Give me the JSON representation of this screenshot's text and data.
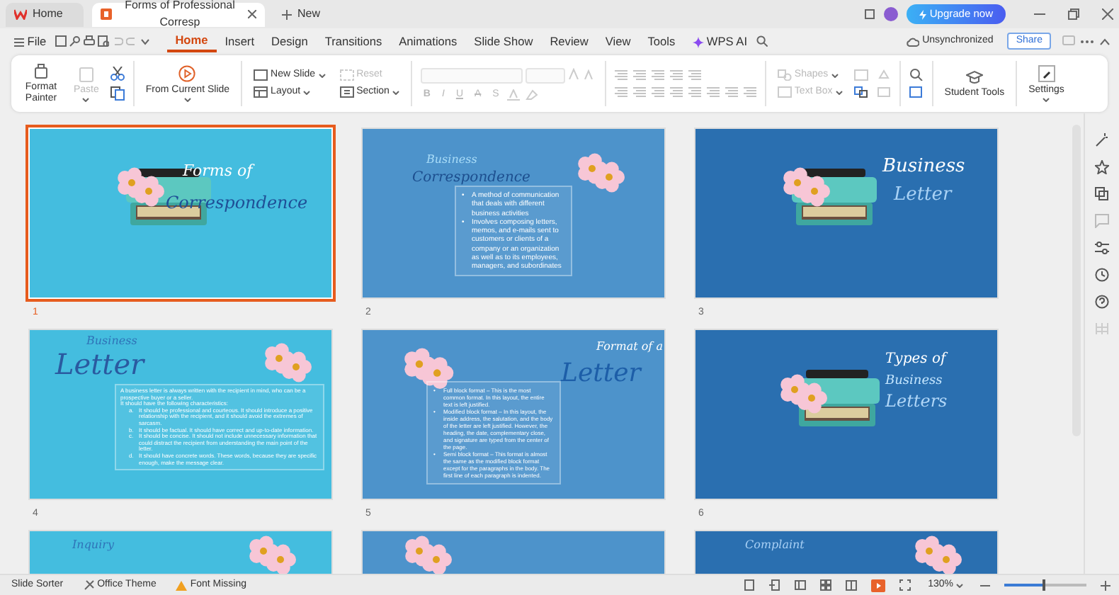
{
  "title_bar": {
    "tabs": [
      {
        "label": "Home",
        "selected": false
      },
      {
        "label": "Forms of Professional Corresp",
        "selected": true
      }
    ],
    "new_tab": "New",
    "upgrade": "Upgrade now"
  },
  "menu": {
    "file": "File",
    "tabs": [
      {
        "label": "Home",
        "selected": true
      },
      {
        "label": "Insert",
        "selected": false
      },
      {
        "label": "Design",
        "selected": false
      },
      {
        "label": "Transitions",
        "selected": false
      },
      {
        "label": "Animations",
        "selected": false
      },
      {
        "label": "Slide Show",
        "selected": false
      },
      {
        "label": "Review",
        "selected": false
      },
      {
        "label": "View",
        "selected": false
      },
      {
        "label": "Tools",
        "selected": false
      }
    ],
    "ai": "WPS AI",
    "sync": "Unsynchronized",
    "share": "Share"
  },
  "ribbon": {
    "format_painter": "Format Painter",
    "paste": {
      "label": "Paste",
      "disabled": true
    },
    "slideshow": "From Current Slide",
    "new_slide": "New Slide",
    "layout": "Layout",
    "reset": {
      "label": "Reset",
      "disabled": true
    },
    "section": "Section",
    "format_buttons": {
      "labels": [
        "B",
        "I",
        "U",
        "A",
        "S"
      ],
      "disabled": true
    },
    "shapes": {
      "label": "Shapes",
      "disabled": true
    },
    "text_box": {
      "label": "Text Box",
      "disabled": true
    },
    "student_tools": "Student Tools",
    "settings": "Settings"
  },
  "slides": [
    {
      "number": "1",
      "selected": true,
      "kind": "typewriter",
      "color": "#44bddf",
      "title_lines": [
        "Forms of",
        "Correspondence"
      ]
    },
    {
      "number": "2",
      "selected": false,
      "kind": "text",
      "color": "#4d93cb",
      "title_lines": [
        "Business",
        "Correspondence"
      ],
      "bullets": [
        {
          "marker": "•",
          "text": "A method of communication that deals with different business activities"
        },
        {
          "marker": "•",
          "text": "Involves composing letters, memos, and e-mails sent to customers or clients of a company or an organization as well as to its employees, managers, and subordinates"
        }
      ]
    },
    {
      "number": "3",
      "selected": false,
      "kind": "typewriter",
      "color": "#2a6fb0",
      "title_lines": [
        "Business",
        "Letter"
      ]
    },
    {
      "number": "4",
      "selected": false,
      "kind": "text",
      "color": "#44bddf",
      "title_lines": [
        "Business",
        "Letter"
      ],
      "paragraphs": [
        "A business letter is always written with the recipient in mind, who can be a prospective buyer or a seller.",
        "It should have the following characteristics:"
      ],
      "items": [
        {
          "marker": "a.",
          "text": "It should be professional and courteous. It should introduce a positive relationship with the recipient, and it should avoid the extremes of sarcasm."
        },
        {
          "marker": "b.",
          "text": "It should be factual. It should have correct and up-to-date information."
        },
        {
          "marker": "c.",
          "text": "It should be concise. It should not include unnecessary information that could distract the recipient from understanding the main point of the letter."
        },
        {
          "marker": "d.",
          "text": "It should have concrete words. These words, because they are specific enough, make the message clear."
        }
      ]
    },
    {
      "number": "5",
      "selected": false,
      "kind": "text",
      "color": "#4d93cb",
      "title_lines": [
        "Format of a",
        "Letter"
      ],
      "bullets": [
        {
          "marker": "•",
          "text": "Full block format – This is the most common format. In this layout, the entire text is left justified."
        },
        {
          "marker": "•",
          "text": "Modified block format – In this layout, the inside address, the salutation, and the body of the letter are left justified. However, the heading, the date, complementary close, and signature are typed from the center of the page."
        },
        {
          "marker": "•",
          "text": "Semi block format – This format is almost the same as the modified block format except for the paragraphs in the body. The first line of each paragraph is indented."
        }
      ]
    },
    {
      "number": "6",
      "selected": false,
      "kind": "typewriter",
      "color": "#2a6fb0",
      "title_lines": [
        "Types of",
        "Business",
        "Letters"
      ]
    },
    {
      "selected": false,
      "kind": "partial",
      "color": "#44bddf",
      "title_lines": [
        "Inquiry"
      ]
    },
    {
      "selected": false,
      "kind": "partial",
      "color": "#4d93cb"
    },
    {
      "selected": false,
      "kind": "partial",
      "color": "#2a6fb0",
      "title_lines": [
        "Complaint"
      ]
    }
  ],
  "status_bar": {
    "view": "Slide Sorter",
    "theme": "Office Theme",
    "font_warning": "Font Missing",
    "zoom": "130%",
    "zoom_slider": {
      "level": 0.48
    }
  }
}
